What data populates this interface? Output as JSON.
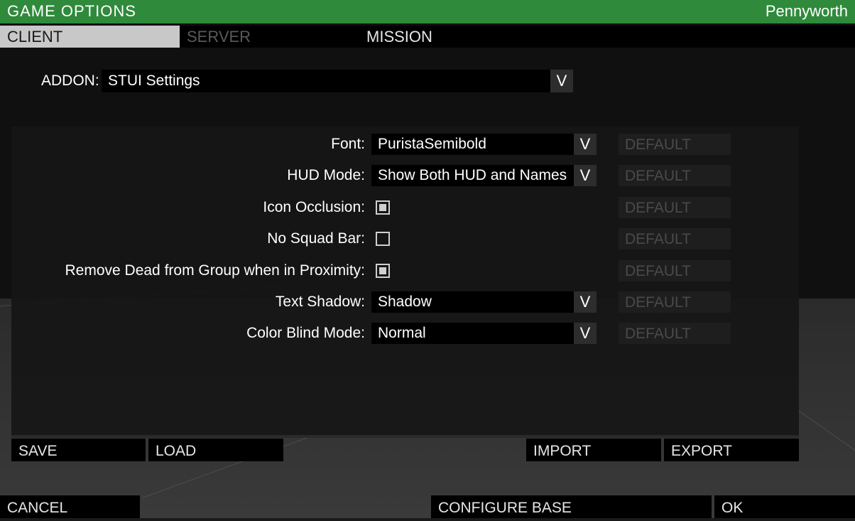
{
  "header": {
    "title": "GAME OPTIONS",
    "username": "Pennyworth"
  },
  "tabs": [
    {
      "label": "CLIENT",
      "active": true
    },
    {
      "label": "SERVER",
      "active": false
    },
    {
      "label": "MISSION",
      "active": false
    }
  ],
  "addon": {
    "label": "ADDON:",
    "value": "STUI Settings"
  },
  "settings": [
    {
      "label": "Font:",
      "type": "dropdown",
      "value": "PuristaSemibold",
      "default_label": "DEFAULT"
    },
    {
      "label": "HUD Mode:",
      "type": "dropdown",
      "value": "Show Both HUD and Names",
      "default_label": "DEFAULT"
    },
    {
      "label": "Icon Occlusion:",
      "type": "checkbox",
      "checked": true,
      "default_label": "DEFAULT"
    },
    {
      "label": "No Squad Bar:",
      "type": "checkbox",
      "checked": false,
      "default_label": "DEFAULT"
    },
    {
      "label": "Remove Dead from Group when in Proximity:",
      "type": "checkbox",
      "checked": true,
      "default_label": "DEFAULT"
    },
    {
      "label": "Text Shadow:",
      "type": "dropdown",
      "value": "Shadow",
      "default_label": "DEFAULT"
    },
    {
      "label": "Color Blind Mode:",
      "type": "dropdown",
      "value": "Normal",
      "default_label": "DEFAULT"
    }
  ],
  "actions": {
    "save": "SAVE",
    "load": "LOAD",
    "import": "IMPORT",
    "export": "EXPORT"
  },
  "footer": {
    "cancel": "CANCEL",
    "configure_base": "CONFIGURE BASE",
    "ok": "OK"
  },
  "icons": {
    "dropdown": "chevron-down-icon",
    "chevron_glyph": "V"
  },
  "colors": {
    "accent": "#2f8a3b",
    "active_tab": "#c8c8c8",
    "disabled_text": "#4a4a4a"
  }
}
